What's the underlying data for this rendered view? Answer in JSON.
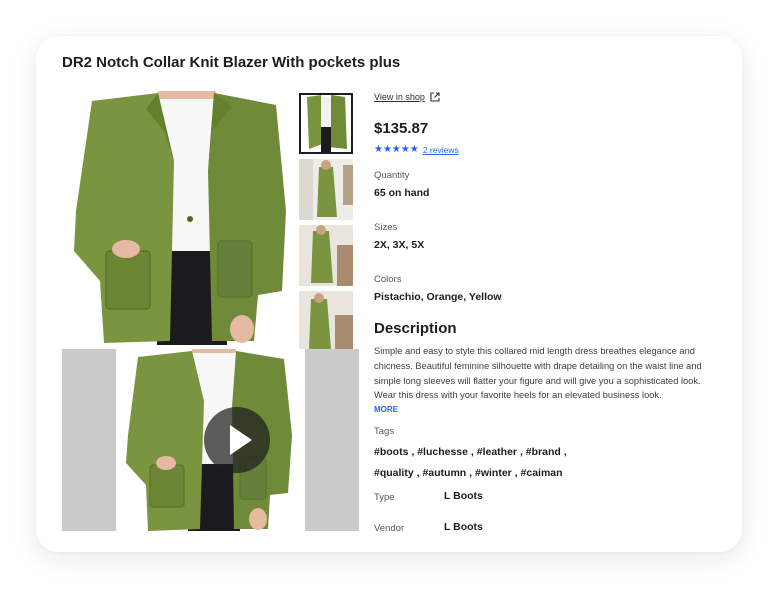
{
  "product": {
    "title": "DR2 Notch Collar Knit Blazer With pockets plus",
    "view_in_shop": "View in shop",
    "price": "$135.87",
    "stars": "★★★★★",
    "reviews": "2 reviews",
    "quantity_label": "Quantity",
    "quantity_value": "65 on hand",
    "sizes_label": "Sizes",
    "sizes_value": "2X, 3X, 5X",
    "colors_label": "Colors",
    "colors_value": "Pistachio, Orange, Yellow",
    "description_heading": "Description",
    "description": "Simple and easy to style this collared mid length dress breathes elegance and chicness. Beautiful feminine silhouette with drape detailing on the waist line and simple long sleeves will flatter your figure and will give you a sophisticated look. Wear this dress with your favorite heels for an elevated business look.",
    "more": "MORE",
    "tags_label": "Tags",
    "tags": [
      "#boots",
      "#luchesse",
      "#leather",
      "#brand",
      "#quality",
      "#autumn",
      "#winter",
      "#caiman"
    ],
    "type_label": "Type",
    "type_value": "L Boots",
    "vendor_label": "Vendor",
    "vendor_value": "L Boots"
  },
  "colors": {
    "blazer": "#7a9440",
    "accent": "#2563eb",
    "placeholder_gray": "#cbcbcb"
  }
}
